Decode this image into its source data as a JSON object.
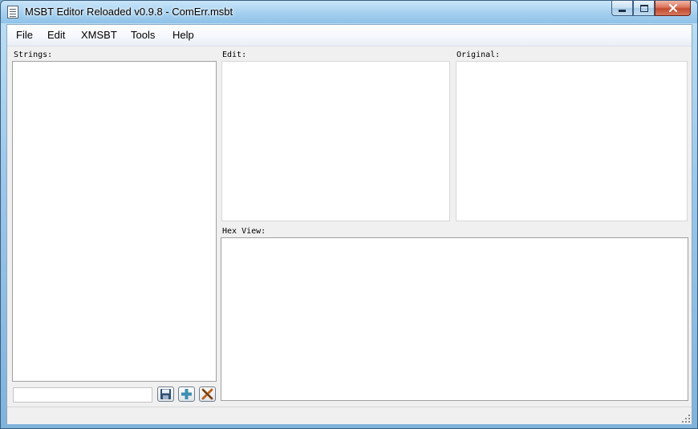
{
  "window": {
    "title": "MSBT Editor Reloaded v0.9.8 - ComErr.msbt"
  },
  "menu": {
    "items": [
      "File",
      "Edit",
      "XMSBT",
      "Tools",
      "Help"
    ]
  },
  "panels": {
    "strings_label": "Strings:",
    "edit_label": "Edit:",
    "original_label": "Original:",
    "hex_label": "Hex View:"
  },
  "search": {
    "value": ""
  },
  "toolbar": {
    "icons": [
      "save-icon",
      "add-icon",
      "delete-icon"
    ]
  },
  "colors": {
    "save_icon": "#2f4f6f",
    "add_icon": "#3d8fb0",
    "delete_icon": "#b8641f"
  }
}
